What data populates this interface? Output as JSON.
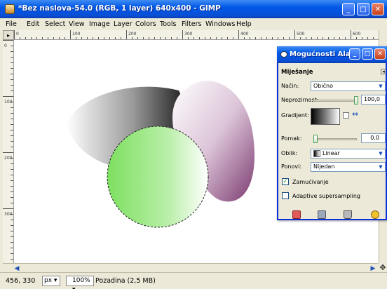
{
  "window": {
    "title": "*Bez naslova-54.0 (RGB, 1 layer) 640x400 - GIMP",
    "minimize": "_",
    "maximize": "□",
    "close": "✕"
  },
  "menu": [
    "File",
    "Edit",
    "Select",
    "View",
    "Image",
    "Layer",
    "Colors",
    "Tools",
    "Filters",
    "Windows",
    "Help"
  ],
  "rulers": {
    "top_ticks": [
      "0",
      "100",
      "200",
      "300",
      "400",
      "500",
      "600"
    ],
    "left_ticks": [
      "0",
      "100",
      "200",
      "300"
    ]
  },
  "canvas": {
    "colors": {
      "dark_blob": "#2e2e2e",
      "purple_blob": "#8a4a7e",
      "green_circle": "#8ce070"
    },
    "selection": "circle-marching-ants"
  },
  "statusbar": {
    "coords": "456, 330",
    "unit": "px",
    "zoom": "100%",
    "info": "Pozadina (2,5 MB)"
  },
  "tool_options": {
    "title": "Mogućnosti Alata",
    "section": "Miješanje",
    "labels": {
      "mode": "Način:",
      "opacity": "Neprozirnost:",
      "gradient": "Gradijent:",
      "offset": "Pomak:",
      "shape": "Oblik:",
      "repeat": "Ponovi:"
    },
    "mode_value": "Obično",
    "opacity_value": "100,0",
    "offset_value": "0,0",
    "shape_value": "Linear",
    "repeat_value": "Nijedan",
    "dithering_label": "Zamućivanje",
    "dithering_checked": true,
    "adaptive_label": "Adaptive supersampling",
    "adaptive_checked": false,
    "opacity_level": 1.0,
    "offset_level": 0.0,
    "footer_icons": [
      "save-icon",
      "restore-icon",
      "delete-icon",
      "reset-icon"
    ]
  }
}
